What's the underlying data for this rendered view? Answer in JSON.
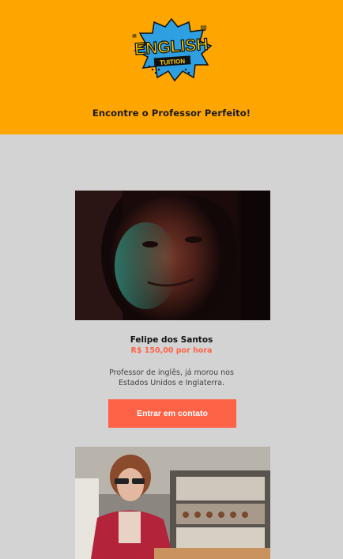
{
  "header": {
    "logo_word": "ENGLISH",
    "logo_sub": "TUITION",
    "tagline": "Encontre o Professor Perfeito!",
    "background": "#ffa500"
  },
  "teachers": [
    {
      "name": "Felipe dos Santos",
      "price": "R$ 150,00 por hora",
      "description_line1": "Professor de inglês, já morou nos",
      "description_line2": "Estados Unidos e Inglaterra.",
      "cta_label": "Entrar em contato"
    }
  ],
  "colors": {
    "accent": "#ff6347",
    "page_background": "#d3d3d3",
    "header_background": "#ffa500"
  }
}
